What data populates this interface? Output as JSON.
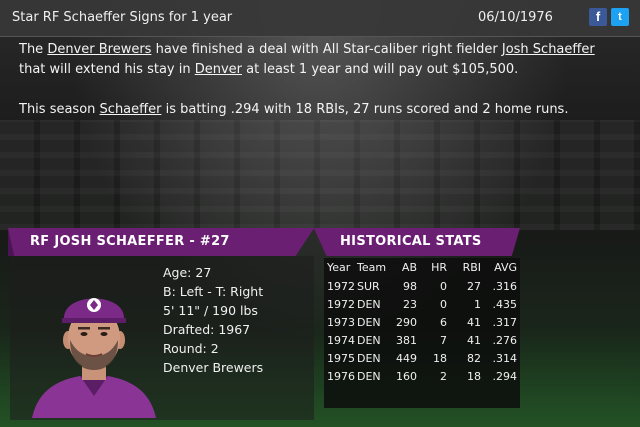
{
  "header": {
    "headline": "Star RF Schaeffer Signs for 1 year",
    "date": "06/10/1976",
    "facebook_icon": "f",
    "twitter_icon": "t"
  },
  "article": {
    "p1": {
      "t1": "The ",
      "team": "Denver Brewers",
      "t2": " have finished a deal with All Star-caliber right fielder ",
      "player": "Josh Schaeffer",
      "t3": " that will extend his stay in ",
      "city": "Denver",
      "t4": " at least 1 year and will pay out $105,500."
    },
    "p2": {
      "t1": "This season ",
      "player": "Schaeffer",
      "t2": " is batting .294 with 18 RBIs, 27 runs scored and 2 home runs."
    }
  },
  "player": {
    "ribbon": "RF JOSH SCHAEFFER - #27",
    "age": "Age: 27",
    "bats_throws": "B: Left - T: Right",
    "height_weight": "5' 11\" / 190 lbs",
    "drafted": "Drafted: 1967",
    "round": "Round: 2",
    "team": "Denver Brewers",
    "cap_color": "#7b2b87"
  },
  "stats": {
    "ribbon": "HISTORICAL STATS",
    "headers": [
      "Year",
      "Team",
      "AB",
      "HR",
      "RBI",
      "AVG"
    ],
    "rows": [
      [
        "1972",
        "SUR",
        "98",
        "0",
        "27",
        ".316"
      ],
      [
        "1972",
        "DEN",
        "23",
        "0",
        "1",
        ".435"
      ],
      [
        "1973",
        "DEN",
        "290",
        "6",
        "41",
        ".317"
      ],
      [
        "1974",
        "DEN",
        "381",
        "7",
        "41",
        ".276"
      ],
      [
        "1975",
        "DEN",
        "449",
        "18",
        "82",
        ".314"
      ],
      [
        "1976",
        "DEN",
        "160",
        "2",
        "18",
        ".294"
      ]
    ]
  },
  "colors": {
    "accent_purple": "#6a1f73",
    "header_bg": "#373737"
  }
}
